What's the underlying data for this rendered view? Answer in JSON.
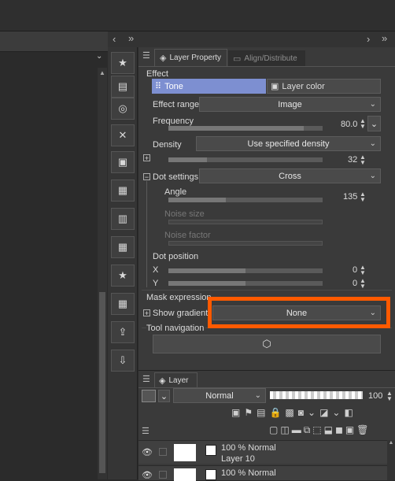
{
  "panel_nav": {
    "left_arrows": "‹",
    "collapse": "»",
    "right_arrow": "›",
    "collapse_right": "»"
  },
  "tabs": {
    "layer_property": "Layer Property",
    "align_distribute": "Align/Distribute"
  },
  "effect": {
    "section_label": "Effect",
    "tone_label": "Tone",
    "layer_color_label": "Layer color",
    "effect_range_label": "Effect range",
    "effect_range_value": "Image",
    "frequency_label": "Frequency",
    "frequency_value": "80.0",
    "frequency_fill": 0.88,
    "density_label": "Density",
    "density_value": "Use specified density",
    "density_number": "32",
    "density_fill": 0.25,
    "dot_settings_label": "Dot settings",
    "dot_settings_value": "Cross",
    "angle_label": "Angle",
    "angle_value": "135",
    "angle_fill": 0.37,
    "noise_size_label": "Noise size",
    "noise_factor_label": "Noise factor",
    "dot_position_label": "Dot position",
    "x_label": "X",
    "x_value": "0",
    "y_label": "Y",
    "y_value": "0",
    "mask_label": "Mask expression",
    "show_gradient_label": "Show gradient",
    "show_gradient_value": "None",
    "tool_nav_label": "Tool navigation"
  },
  "layer_panel": {
    "tab_label": "Layer",
    "blend_mode": "Normal",
    "opacity": "100",
    "layers": [
      {
        "mode": "100 % Normal",
        "name": "Layer 10"
      },
      {
        "mode": "100 % Normal",
        "name": ""
      }
    ]
  },
  "colors": {
    "accent": "#ff5a00",
    "tone_active": "#7d8fd1"
  }
}
